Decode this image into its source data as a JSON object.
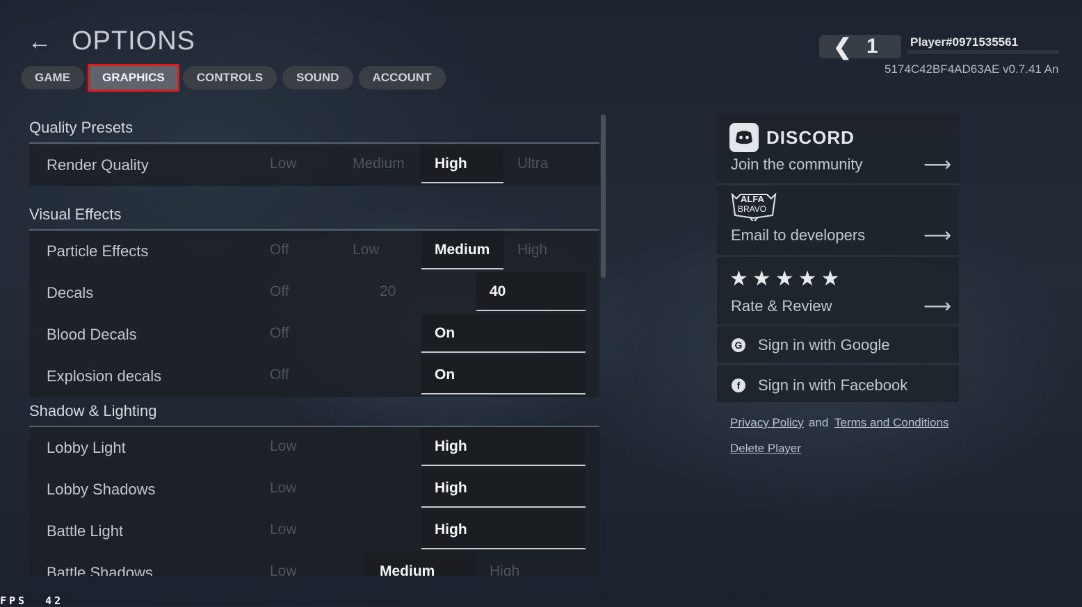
{
  "header": {
    "back_icon": "arrow-left-icon",
    "title": "OPTIONS",
    "tabs": [
      {
        "label": "GAME",
        "active": false
      },
      {
        "label": "GRAPHICS",
        "active": true
      },
      {
        "label": "CONTROLS",
        "active": false
      },
      {
        "label": "SOUND",
        "active": false
      },
      {
        "label": "ACCOUNT",
        "active": false
      }
    ]
  },
  "player": {
    "level": "1",
    "name": "Player#0971535561",
    "id_version": "5174C42BF4AD63AE v0.7.41 An"
  },
  "settings": {
    "quality_presets": {
      "title": "Quality Presets",
      "render_quality": {
        "label": "Render Quality",
        "options": [
          "Low",
          "Medium",
          "High",
          "Ultra"
        ],
        "selected": "High"
      }
    },
    "visual_effects": {
      "title": "Visual Effects",
      "particle_effects": {
        "label": "Particle Effects",
        "options": [
          "Off",
          "Low",
          "Medium",
          "High"
        ],
        "selected": "Medium"
      },
      "decals": {
        "label": "Decals",
        "options": [
          "Off",
          "20",
          "40"
        ],
        "selected": "40"
      },
      "blood_decals": {
        "label": "Blood Decals",
        "options": [
          "Off",
          "On"
        ],
        "selected": "On"
      },
      "explosion_decals": {
        "label": "Explosion decals",
        "options": [
          "Off",
          "On"
        ],
        "selected": "On"
      }
    },
    "shadow_lighting": {
      "title": "Shadow & Lighting",
      "lobby_light": {
        "label": "Lobby Light",
        "options": [
          "Low",
          "High"
        ],
        "selected": "High"
      },
      "lobby_shadows": {
        "label": "Lobby Shadows",
        "options": [
          "Low",
          "High"
        ],
        "selected": "High"
      },
      "battle_light": {
        "label": "Battle Light",
        "options": [
          "Low",
          "High"
        ],
        "selected": "High"
      },
      "battle_shadows": {
        "label": "Battle Shadows",
        "options": [
          "Low",
          "Medium",
          "High"
        ],
        "selected": "Medium"
      }
    }
  },
  "side": {
    "discord": {
      "brand": "DISCORD",
      "text": "Join the community",
      "icon": "discord-icon"
    },
    "developers": {
      "logo_line1": "ALFA",
      "logo_line2": "BRAVO",
      "text": "Email to developers"
    },
    "rate": {
      "stars": "★★★★★",
      "star_count": 5,
      "text": "Rate & Review"
    },
    "google": {
      "icon": "google-icon",
      "text": "Sign in with Google"
    },
    "facebook": {
      "icon": "facebook-icon",
      "text": "Sign in with Facebook"
    },
    "arrow_glyph": "⟶"
  },
  "links": {
    "privacy": "Privacy Policy",
    "and": "and",
    "terms": "Terms and Conditions",
    "delete": "Delete Player"
  },
  "fps": {
    "label": "FPS",
    "value": "42"
  }
}
